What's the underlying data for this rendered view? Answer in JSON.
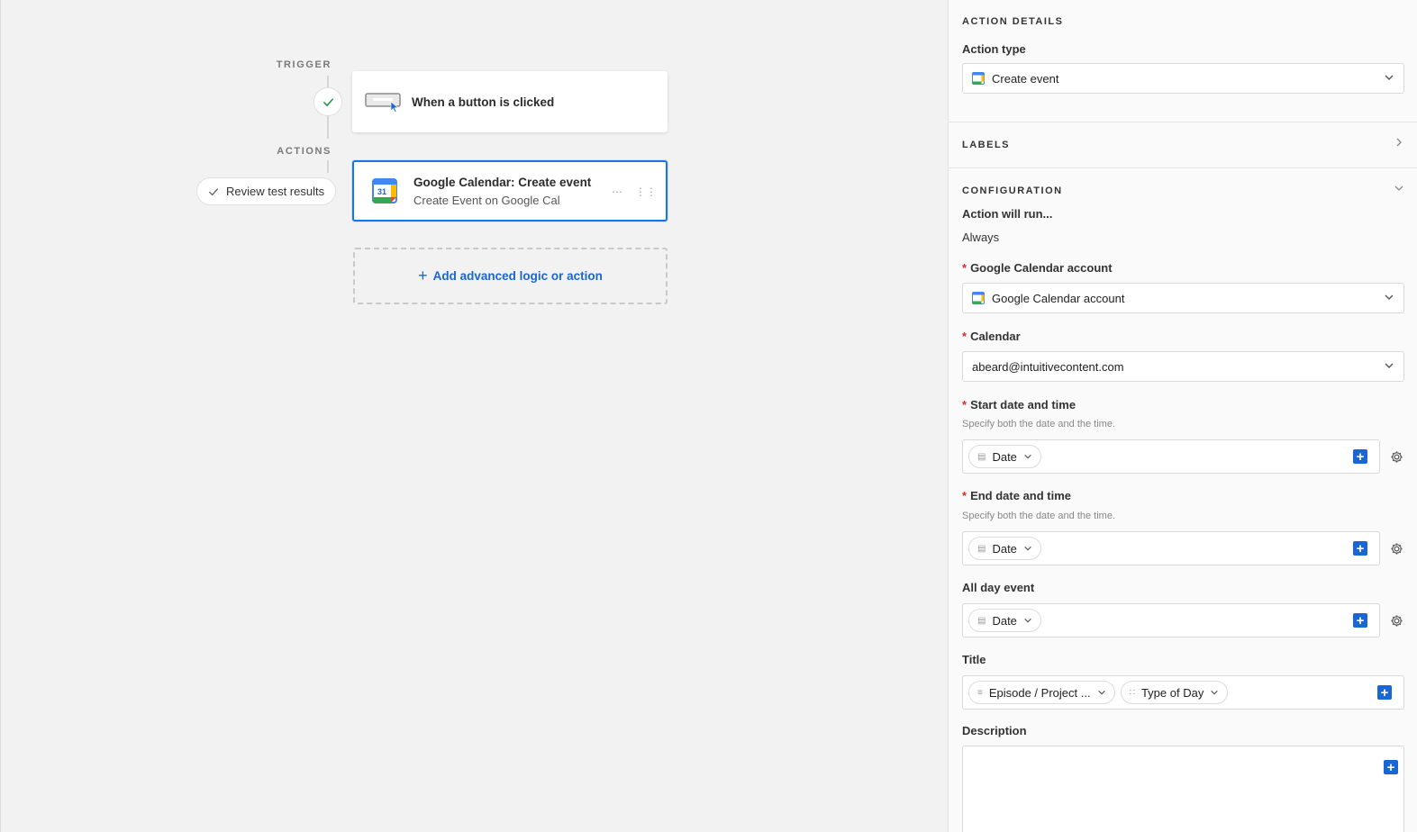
{
  "canvas": {
    "trigger_label": "TRIGGER",
    "actions_label": "ACTIONS",
    "trigger_card": {
      "title": "When a button is clicked"
    },
    "action_card": {
      "title": "Google Calendar: Create event",
      "subtitle": "Create Event on Google Cal",
      "calendar_day": "31"
    },
    "review_button": "Review test results",
    "add_action": "Add advanced logic or action"
  },
  "panel": {
    "action_details_heading": "ACTION DETAILS",
    "action_type_label": "Action type",
    "action_type_value": "Create event",
    "labels_heading": "LABELS",
    "configuration_heading": "CONFIGURATION",
    "run_label": "Action will run...",
    "run_value": "Always",
    "account_label": "Google Calendar account",
    "account_value": "Google Calendar account",
    "calendar_label": "Calendar",
    "calendar_value": "abeard@intuitivecontent.com",
    "start_label": "Start date and time",
    "start_help": "Specify both the date and the time.",
    "start_token": "Date",
    "end_label": "End date and time",
    "end_help": "Specify both the date and the time.",
    "end_token": "Date",
    "allday_label": "All day event",
    "allday_token": "Date",
    "title_label": "Title",
    "title_token_1": "Episode / Project ...",
    "title_token_2": "Type of Day",
    "description_label": "Description"
  },
  "colors": {
    "accent": "#1a66d2",
    "selected_border": "#1a73e8",
    "required": "#d32f2f"
  }
}
